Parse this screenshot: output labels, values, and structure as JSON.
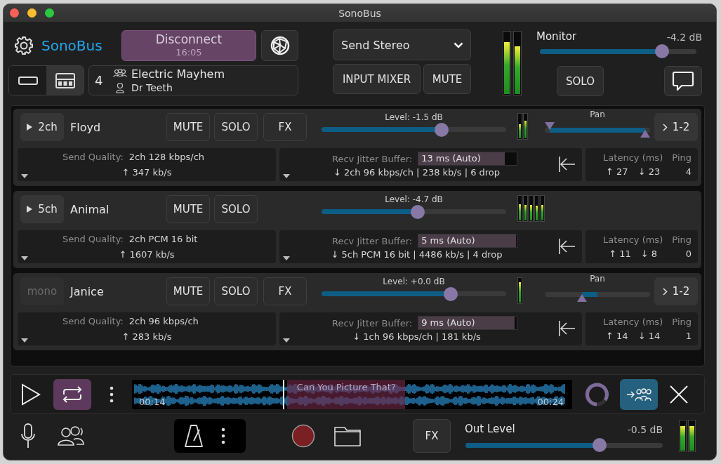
{
  "window": {
    "title": "SonoBus"
  },
  "header": {
    "app_name": "SonoBus",
    "connect": {
      "label": "Disconnect",
      "time": "16:05"
    },
    "layouts": [
      {
        "selected": false
      },
      {
        "selected": true
      }
    ],
    "group": {
      "count": "4",
      "name": "Electric Mayhem",
      "user": "Dr Teeth"
    },
    "send_mode": "Send Stereo",
    "input_mixer": "INPUT MIXER",
    "mute": "MUTE",
    "meters": [
      {
        "level": 0.82
      },
      {
        "level": 0.76
      }
    ],
    "monitor": {
      "label": "Monitor",
      "reading": "-4.2 dB",
      "level": 0.78
    },
    "solo": "SOLO"
  },
  "peers": [
    {
      "channels": "2ch",
      "expanded": false,
      "disabled": false,
      "name": "Floyd",
      "buttons": [
        "MUTE",
        "SOLO",
        "FX"
      ],
      "level_label": "Level: -1.5 dB",
      "level": 0.65,
      "meters": [
        {
          "level": 0.55
        },
        {
          "level": 0.7
        }
      ],
      "pan": {
        "label": "Pan",
        "kind": "stereo",
        "handles": [
          {
            "level": 0
          },
          {
            "level": 1
          }
        ]
      },
      "output": "1-2",
      "send_quality_label": "Send Quality:",
      "send_quality": "2ch 128 kbps/ch",
      "send_rate": "↑ 347 kb/s",
      "jitter_label": "Recv Jitter Buffer:",
      "jitter": {
        "value": "13 ms (Auto)",
        "level": 0.88
      },
      "recv_info": "↓ 2ch 96 kbps/ch | 238 kb/s | 6 drop",
      "latency_label": "Latency (ms)",
      "ping_label": "Ping",
      "latency_up": "↑ 27",
      "latency_down": "↓ 23",
      "ping": "4"
    },
    {
      "channels": "5ch",
      "expanded": false,
      "disabled": false,
      "name": "Animal",
      "buttons": [
        "MUTE",
        "SOLO"
      ],
      "level_label": "Level: -4.7 dB",
      "level": 0.52,
      "meters": [
        {
          "level": 0.65
        },
        {
          "level": 0.6
        },
        {
          "level": 0.62
        },
        {
          "level": 0.58
        },
        {
          "level": 0.6
        }
      ],
      "send_quality_label": "Send Quality:",
      "send_quality": "2ch PCM 16 bit",
      "send_rate": "↑ 1607 kb/s",
      "jitter_label": "Recv Jitter Buffer:",
      "jitter": {
        "value": "5 ms (Auto)",
        "level": 0.99
      },
      "recv_info": "↓ 5ch PCM 16 bit | 4486 kb/s | 4 drop",
      "latency_label": "Latency (ms)",
      "ping_label": "Ping",
      "latency_up": "↑ 11",
      "latency_down": "↓ 8",
      "ping": "0"
    },
    {
      "channels": "mono",
      "disabled": true,
      "name": "Janice",
      "buttons": [
        "MUTE",
        "SOLO",
        "FX"
      ],
      "level_label": "Level: +0.0 dB",
      "level": 0.7,
      "meters": [
        {
          "level": 0.8
        }
      ],
      "pan": {
        "label": "Pan",
        "kind": "mono",
        "handles": [
          {
            "level": 0.34
          }
        ]
      },
      "output": "1-2",
      "send_quality_label": "Send Quality:",
      "send_quality": "2ch 96 kbps/ch",
      "send_rate": "↑ 283 kb/s",
      "jitter_label": "Recv Jitter Buffer:",
      "jitter": {
        "value": "9 ms (Auto)",
        "level": 0.98
      },
      "recv_info": "↓ 1ch 96 kbps/ch | 181 kb/s",
      "latency_label": "Latency (ms)",
      "ping_label": "Ping",
      "latency_up": "↑ 14",
      "latency_down": "↓ 14",
      "ping": "1"
    }
  ],
  "player": {
    "loop_on": true,
    "track_title": "Can You Picture That?",
    "time_start": "00:14",
    "time_end": "00:24",
    "level": 0.343,
    "send_to_group_on": true
  },
  "footer": {
    "fx": "FX",
    "out_label": "Out Level",
    "out_reading": "-0.5 dB",
    "level": 0.68,
    "meters": [
      {
        "level": 0.8
      },
      {
        "level": 0.8
      }
    ]
  }
}
